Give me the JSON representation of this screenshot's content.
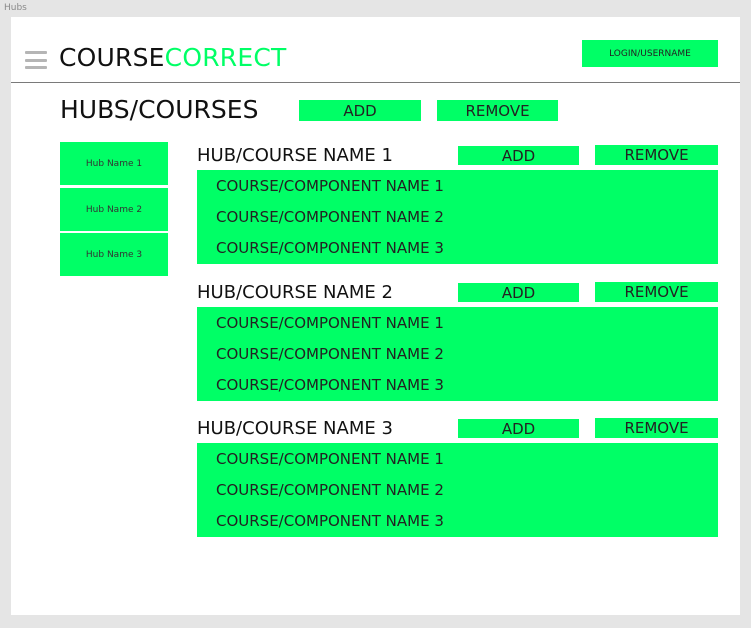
{
  "frame_label": "Hubs",
  "header": {
    "logo_part1": "COURSE",
    "logo_part2": "CORRECT",
    "login_label": "LOGIN/USERNAME"
  },
  "page": {
    "title": "HUBS/COURSES",
    "add_label": "ADD",
    "remove_label": "REMOVE"
  },
  "sidebar": {
    "items": [
      {
        "label": "Hub Name 1"
      },
      {
        "label": "Hub Name 2"
      },
      {
        "label": "Hub Name 3"
      }
    ]
  },
  "hubs": [
    {
      "title": "HUB/COURSE NAME 1",
      "add_label": "ADD",
      "remove_label": "REMOVE",
      "courses": [
        "COURSE/COMPONENT NAME 1",
        "COURSE/COMPONENT NAME 2",
        "COURSE/COMPONENT NAME 3"
      ]
    },
    {
      "title": "HUB/COURSE NAME 2",
      "add_label": "ADD",
      "remove_label": "REMOVE",
      "courses": [
        "COURSE/COMPONENT NAME 1",
        "COURSE/COMPONENT NAME 2",
        "COURSE/COMPONENT NAME 3"
      ]
    },
    {
      "title": "HUB/COURSE NAME 3",
      "add_label": "ADD",
      "remove_label": "REMOVE",
      "courses": [
        "COURSE/COMPONENT NAME 1",
        "COURSE/COMPONENT NAME 2",
        "COURSE/COMPONENT NAME 3"
      ]
    }
  ],
  "colors": {
    "accent": "#00ff66",
    "background": "#e5e5e5",
    "canvas": "#ffffff"
  },
  "icons": {
    "menu": "hamburger-menu-icon"
  }
}
